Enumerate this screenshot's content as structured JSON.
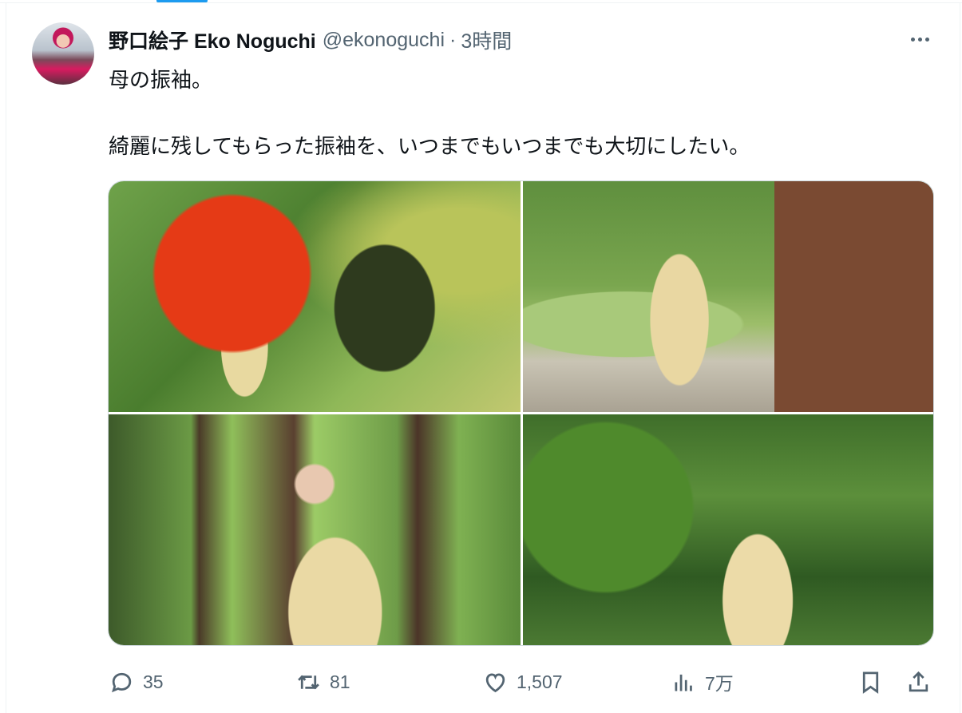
{
  "tweet": {
    "display_name": "野口絵子 Eko Noguchi",
    "handle": "@ekonoguchi",
    "separator": "·",
    "time": "3時間",
    "line1": "母の振袖。",
    "line2": "綺麗に残してもらった振袖を、いつまでもいつまでも大切にしたい。"
  },
  "actions": {
    "replies": "35",
    "retweets": "81",
    "likes": "1,507",
    "views": "7万"
  },
  "icons": {
    "reply": "reply-icon",
    "retweet": "retweet-icon",
    "like": "heart-icon",
    "views": "views-icon",
    "bookmark": "bookmark-icon",
    "share": "share-icon",
    "more": "more-icon"
  },
  "colors": {
    "accent": "#1d9bf0",
    "text": "#0f1419",
    "secondary": "#536471"
  }
}
